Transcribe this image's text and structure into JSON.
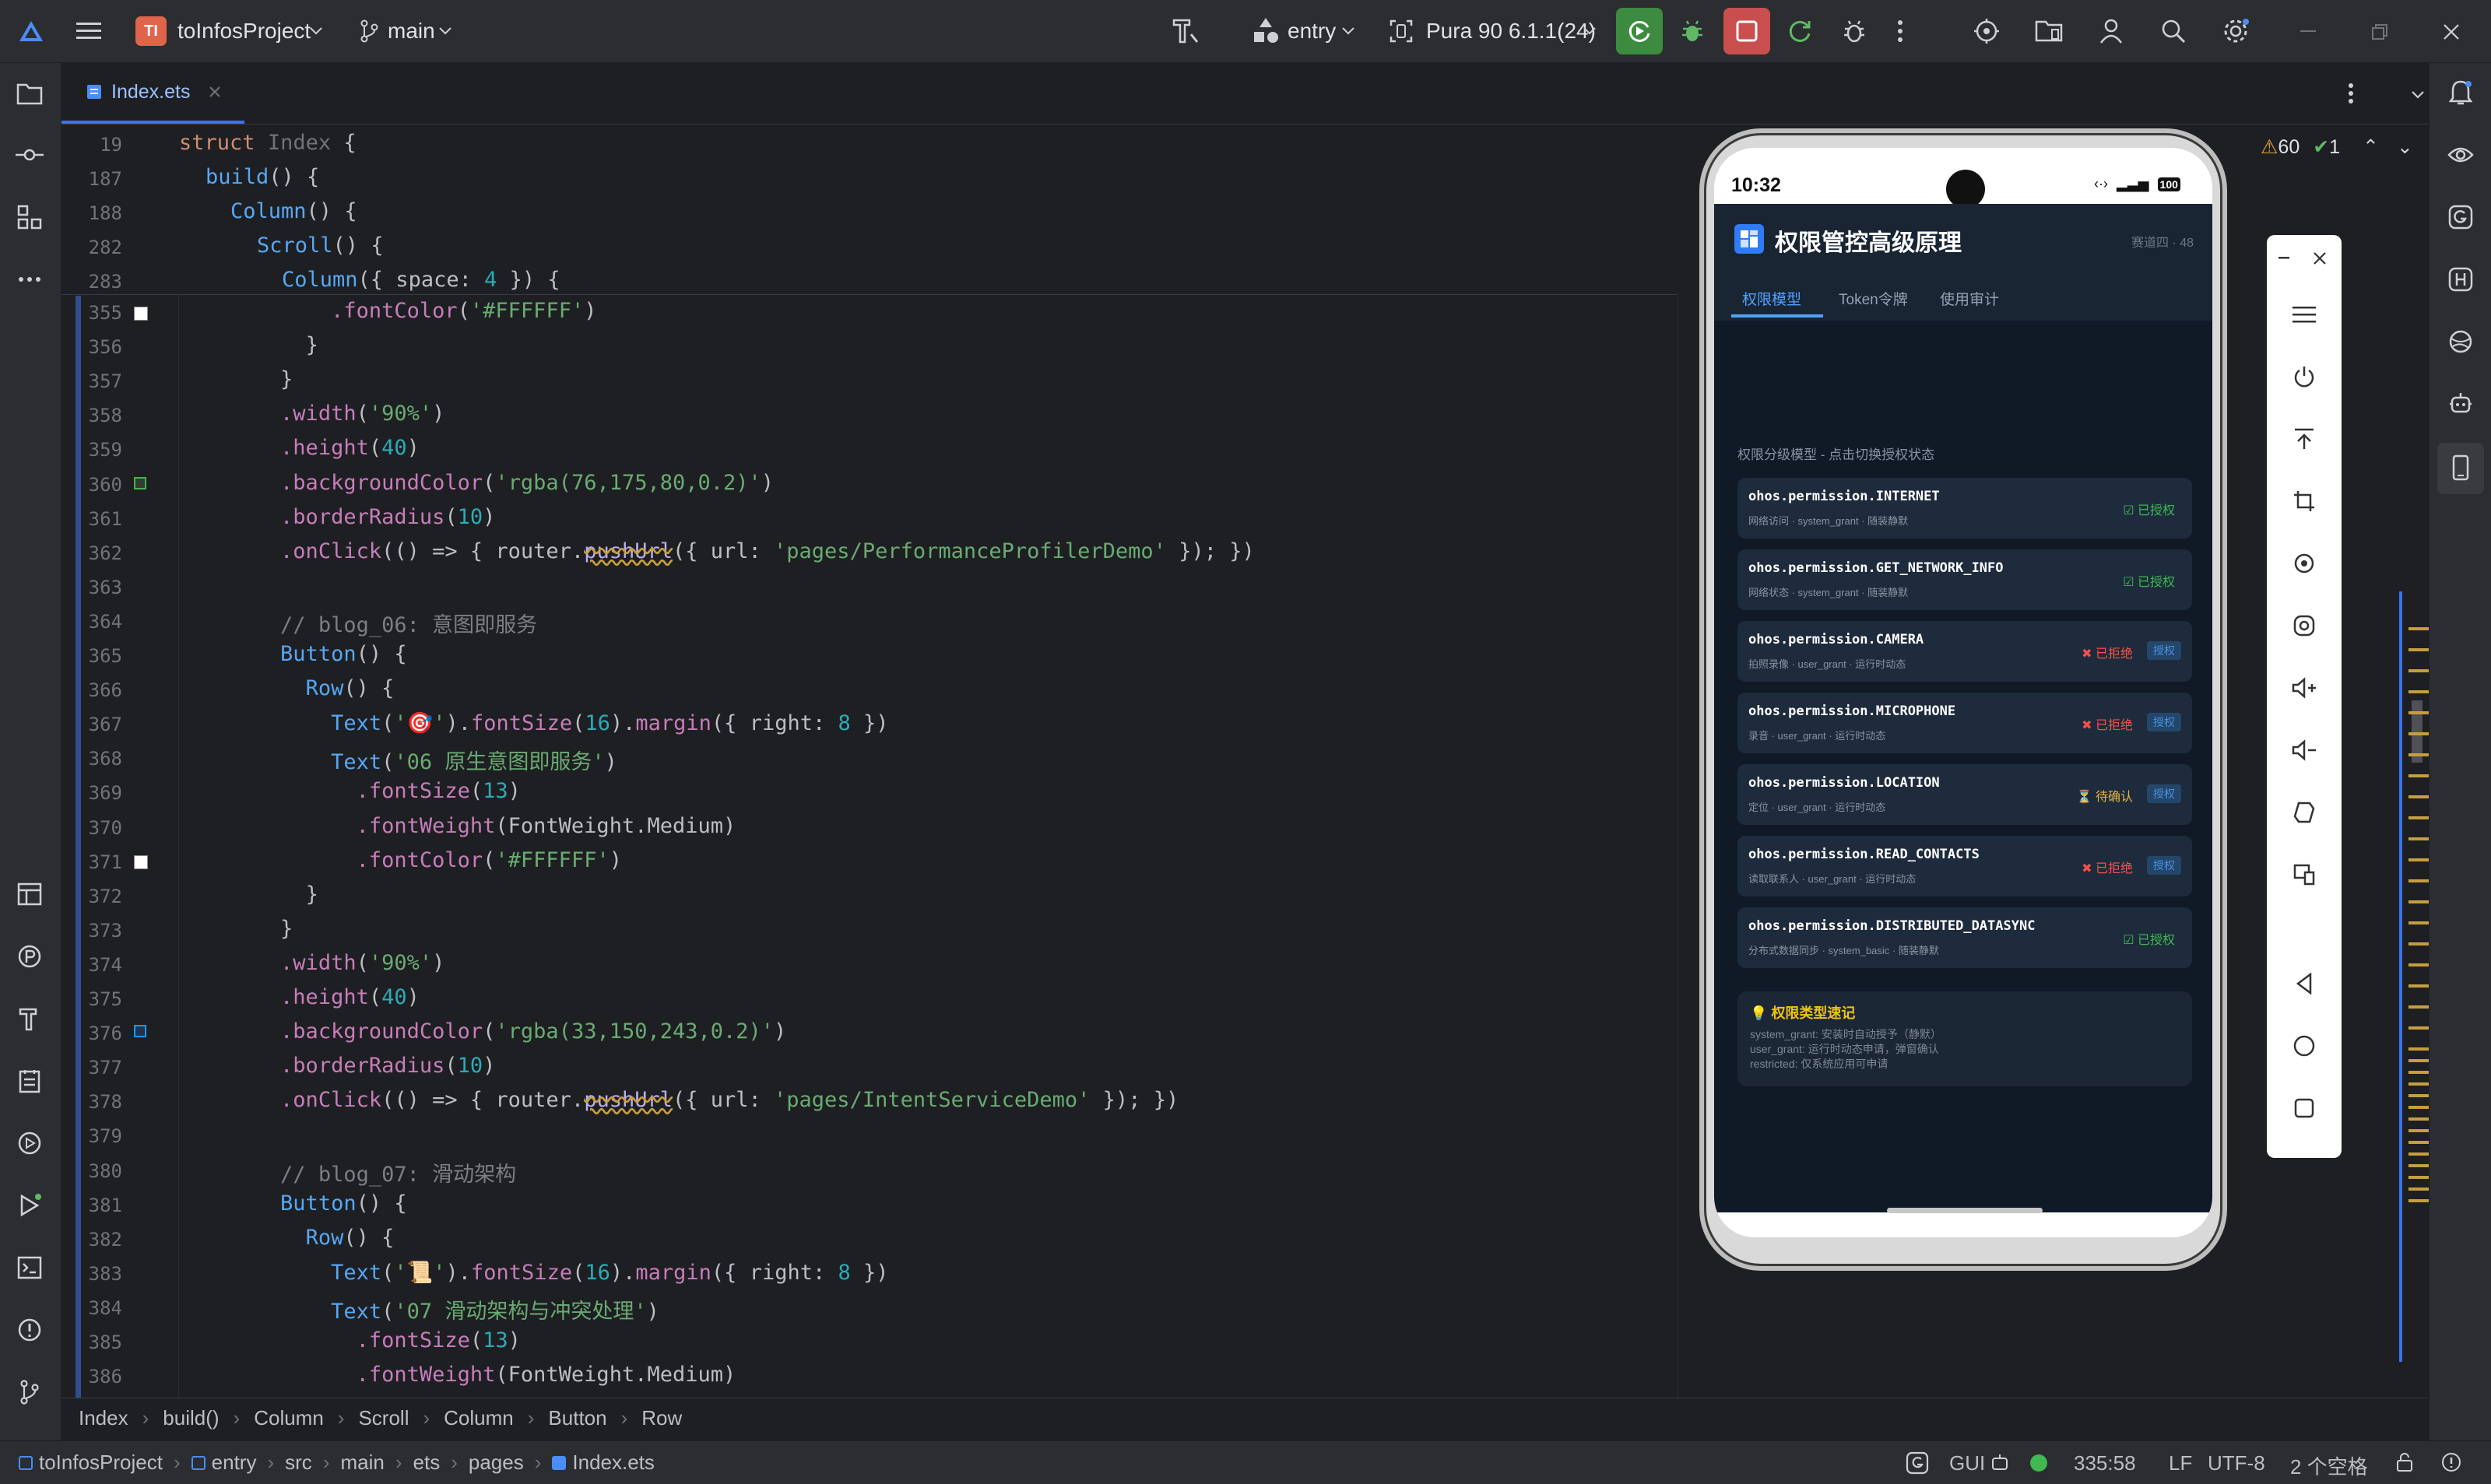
{
  "titlebar": {
    "project_initials": "TI",
    "project_name": "toInfosProject",
    "branch": "main",
    "module": "entry",
    "device": "Pura 90 6.1.1(24)",
    "accent_run": "#3d8b40",
    "accent_stop": "#c94f4f"
  },
  "tabs": [
    {
      "label": "Index.ets",
      "icon": "ets-file-icon"
    }
  ],
  "inspections": {
    "warnings": "60",
    "checks": "1"
  },
  "editor": {
    "sticky": [
      {
        "ln": "19"
      },
      {
        "ln": "187"
      },
      {
        "ln": "188"
      },
      {
        "ln": "282"
      },
      {
        "ln": "283"
      }
    ],
    "lines": [
      "355",
      "356",
      "357",
      "358",
      "359",
      "360",
      "361",
      "362",
      "363",
      "364",
      "365",
      "366",
      "367",
      "368",
      "369",
      "370",
      "371",
      "372",
      "373",
      "374",
      "375",
      "376",
      "377",
      "378",
      "379",
      "380",
      "381",
      "382",
      "383",
      "384",
      "385",
      "386"
    ]
  },
  "crumbs": [
    "Index",
    "build()",
    "Column",
    "Scroll",
    "Column",
    "Button",
    "Row"
  ],
  "status": {
    "path": [
      "toInfosProject",
      "entry",
      "src",
      "main",
      "ets",
      "pages",
      "Index.ets"
    ],
    "gui": "GUI",
    "position": "335:58",
    "line_sep": "LF",
    "encoding": "UTF-8",
    "indent": "2 个空格"
  },
  "phone": {
    "time": "10:32",
    "battery": "100",
    "app_title": "权限管控高级原理",
    "app_subtitle": "赛道四 · 48",
    "tabs": [
      "权限模型",
      "Token令牌",
      "使用审计"
    ],
    "section_label": "权限分级模型 - 点击切换授权状态",
    "permissions": [
      {
        "name": "ohos.permission.INTERNET",
        "desc": "网络访问 · system_grant · 随装静默",
        "state": "已授权",
        "grant_btn": ""
      },
      {
        "name": "ohos.permission.GET_NETWORK_INFO",
        "desc": "网络状态 · system_grant · 随装静默",
        "state": "已授权",
        "grant_btn": ""
      },
      {
        "name": "ohos.permission.CAMERA",
        "desc": "拍照录像 · user_grant · 运行时动态",
        "state": "已拒绝",
        "grant_btn": "授权"
      },
      {
        "name": "ohos.permission.MICROPHONE",
        "desc": "录音 · user_grant · 运行时动态",
        "state": "已拒绝",
        "grant_btn": "授权"
      },
      {
        "name": "ohos.permission.LOCATION",
        "desc": "定位 · user_grant · 运行时动态",
        "state": "待确认",
        "grant_btn": "授权"
      },
      {
        "name": "ohos.permission.READ_CONTACTS",
        "desc": "读取联系人 · user_grant · 运行时动态",
        "state": "已拒绝",
        "grant_btn": "授权"
      },
      {
        "name": "ohos.permission.DISTRIBUTED_DATASYNC",
        "desc": "分布式数据同步 · system_basic · 随装静默",
        "state": "已授权",
        "grant_btn": ""
      }
    ],
    "tip_title": "权限类型速记",
    "tip_lines": [
      "system_grant: 安装时自动授予（静默）",
      "user_grant: 运行时动态申请，弹窗确认",
      "restricted: 仅系统应用可申请"
    ],
    "state_colors": {
      "granted": "#3fb950",
      "denied": "#f85149",
      "pending": "#e3b341"
    }
  }
}
